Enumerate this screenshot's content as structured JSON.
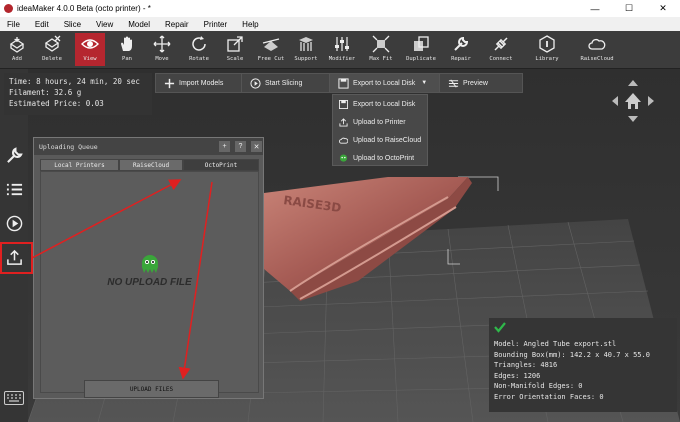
{
  "window": {
    "title": "ideaMaker 4.0.0 Beta (octo printer) - *",
    "controls": [
      "—",
      "☐",
      "✕"
    ]
  },
  "menu": [
    "File",
    "Edit",
    "Slice",
    "View",
    "Model",
    "Repair",
    "Printer",
    "Help"
  ],
  "toolbar": [
    {
      "label": "Add",
      "icon": "add-icon"
    },
    {
      "label": "Delete",
      "icon": "delete-icon"
    },
    {
      "label": "View",
      "icon": "eye-icon"
    },
    {
      "label": "Pan",
      "icon": "hand-icon"
    },
    {
      "label": "Move",
      "icon": "move-icon"
    },
    {
      "label": "Rotate",
      "icon": "rotate-icon"
    },
    {
      "label": "Scale",
      "icon": "scale-icon"
    },
    {
      "label": "Free Cut",
      "icon": "cut-icon"
    },
    {
      "label": "Support",
      "icon": "support-icon"
    },
    {
      "label": "Modifier",
      "icon": "modifier-icon"
    },
    {
      "label": "Max Fit",
      "icon": "maxfit-icon"
    },
    {
      "label": "Duplicate",
      "icon": "duplicate-icon"
    },
    {
      "label": "Repair",
      "icon": "repair-icon"
    },
    {
      "label": "Connect",
      "icon": "connect-icon"
    },
    {
      "label": "Library",
      "icon": "library-icon"
    },
    {
      "label": "RaiseCloud",
      "icon": "cloud-icon"
    }
  ],
  "print_info": {
    "time": "Time: 8 hours, 24 min, 20 sec",
    "filament": "Filament: 32.6 g",
    "price": "Estimated Price: 0.03"
  },
  "actions": {
    "import": "Import Models",
    "slice": "Start Slicing",
    "export": "Export to Local Disk",
    "preview": "Preview"
  },
  "export_menu": [
    {
      "label": "Export to Local Disk",
      "icon": "disk-icon"
    },
    {
      "label": "Upload to Printer",
      "icon": "upload-icon"
    },
    {
      "label": "Upload to RaiseCloud",
      "icon": "cloud-icon"
    },
    {
      "label": "Upload to OctoPrint",
      "icon": "octoprint-icon"
    }
  ],
  "upload_panel": {
    "title": "Uploading Queue",
    "buttons": [
      "+",
      "?",
      "✕"
    ],
    "tabs": [
      "Local Printers",
      "RaiseCloud",
      "OctoPrint"
    ],
    "active_tab": 2,
    "empty_text": "NO UPLOAD FILE",
    "upload_button": "UPLOAD FILES"
  },
  "model_info": {
    "model": "Model: Angled Tube export.stl",
    "bbox": "Bounding Box(mm): 142.2 x 40.7 x 55.0",
    "triangles": "Triangles: 4816",
    "edges": "Edges: 1206",
    "non_manifold": "Non-Manifold Edges: 0",
    "error_faces": "Error Orientation Faces: 0"
  },
  "model_text": "RAISE3D",
  "colors": {
    "accent": "#b5262f",
    "arrow": "#e02020",
    "model": "#b86f65",
    "check": "#2fb84a",
    "octo": "#3aa63a"
  }
}
